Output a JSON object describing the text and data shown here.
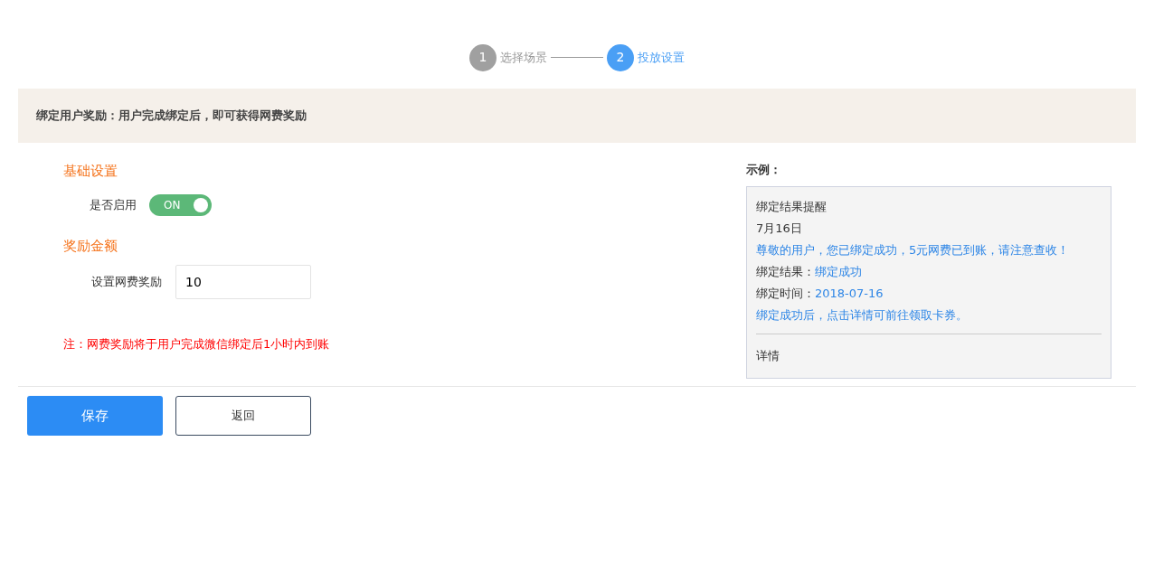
{
  "steps": [
    {
      "number": "1",
      "label": "选择场景",
      "selected": false
    },
    {
      "number": "2",
      "label": "投放设置",
      "selected": true
    }
  ],
  "banner": {
    "text": "绑定用户奖励：用户完成绑定后，即可获得网费奖励"
  },
  "sections": [
    {
      "title": "基础设置",
      "field": {
        "kind": "switch",
        "label": "是否启用",
        "on": true,
        "state_text": "ON"
      }
    },
    {
      "title": "奖励金额",
      "field": {
        "kind": "input",
        "label": "设置网费奖励",
        "value": "10"
      }
    }
  ],
  "note": "注：网费奖励将于用户完成微信绑定后1小时内到账",
  "preview": {
    "heading": "示例：",
    "lines": [
      {
        "kind": "plain",
        "text": "绑定结果提醒"
      },
      {
        "kind": "plain",
        "text": "7月16日"
      },
      {
        "kind": "link",
        "text": "尊敬的用户，您已绑定成功，5元网费已到账，请注意查收！"
      },
      {
        "kind": "pair",
        "label": "绑定结果：",
        "value": "绑定成功"
      },
      {
        "kind": "pair",
        "label": "绑定时间：",
        "value": "2018-07-16"
      },
      {
        "kind": "link",
        "text": "绑定成功后，点击详情可前往领取卡券。"
      }
    ],
    "footer": "详情"
  },
  "buttons": [
    {
      "label": "保存",
      "kind": "primary"
    },
    {
      "label": "返回",
      "kind": "outline"
    }
  ]
}
